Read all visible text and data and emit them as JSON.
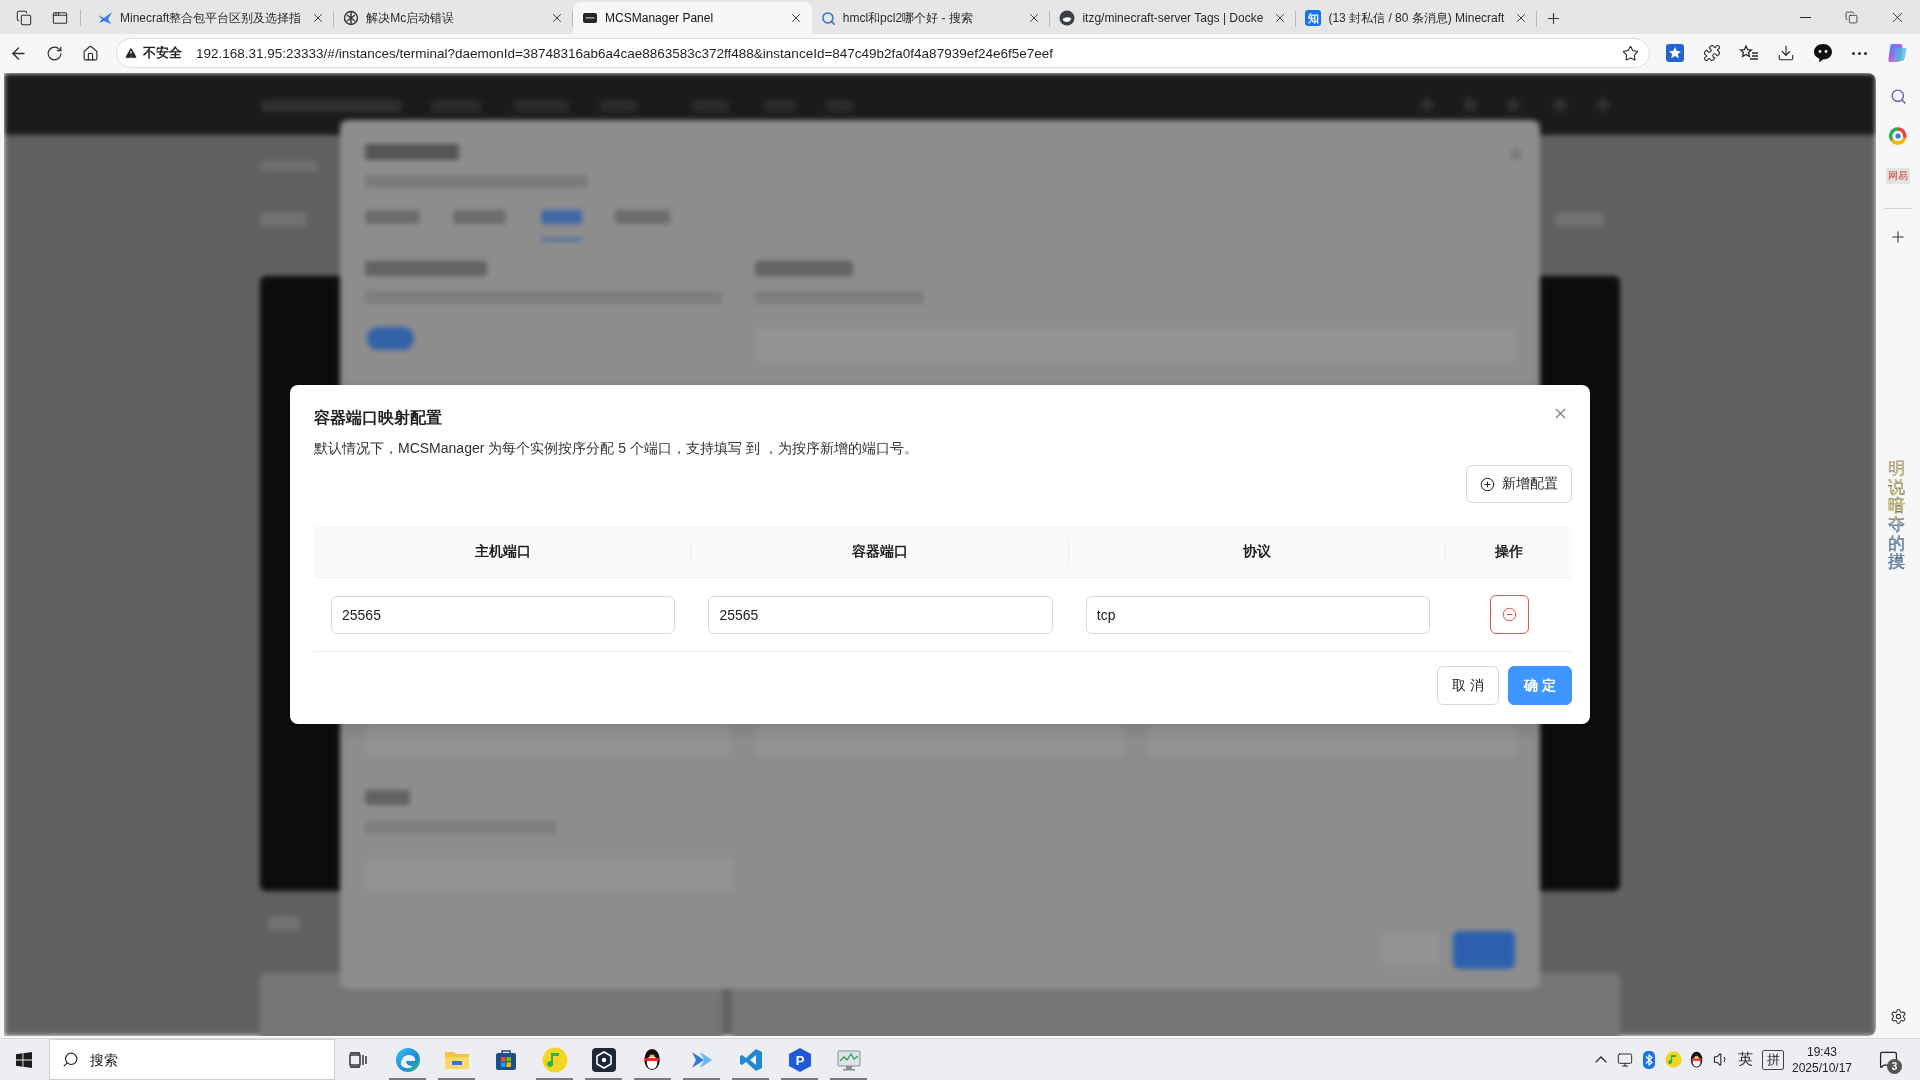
{
  "browser": {
    "tabs": [
      {
        "title": "Minecraft整合包平台区别及选择指",
        "selected": false
      },
      {
        "title": "解决Mc启动错误",
        "selected": false
      },
      {
        "title": "MCSManager Panel",
        "selected": true
      },
      {
        "title": "hmcl和pcl2哪个好 - 搜索",
        "selected": false
      },
      {
        "title": "itzg/minecraft-server Tags | Docke",
        "selected": false
      },
      {
        "title": "(13 封私信 / 80 条消息) Minecraft",
        "selected": false,
        "favicon_text": "知"
      }
    ],
    "address_bar": {
      "security_label": "不安全",
      "url": "192.168.31.95:23333/#/instances/terminal?daemonId=38748316ab6a4cae8863583c372ff488&instanceId=847c49b2fa0f4a87939ef24e6f5e7eef"
    },
    "sidebar": {
      "app_label": "网易"
    }
  },
  "dialog": {
    "title": "容器端口映射配置",
    "description": "默认情况下，MCSManager 为每个实例按序分配 5 个端口，支持填写 到 ，为按序新增的端口号。",
    "add_button": "新增配置",
    "table": {
      "columns": [
        "主机端口",
        "容器端口",
        "协议",
        "操作"
      ],
      "rows": [
        {
          "host_port": "25565",
          "container_port": "25565",
          "protocol": "tcp"
        }
      ]
    },
    "buttons": [
      {
        "label": "取 消",
        "kind": "default"
      },
      {
        "label": "确 定",
        "kind": "primary"
      }
    ]
  },
  "desktop_lyrics": "明说暗夺的摸",
  "taskbar": {
    "search": {
      "placeholder": "搜索"
    },
    "apps": [
      {
        "running": true
      },
      {
        "running": true
      },
      {
        "running": false
      },
      {
        "running": true
      },
      {
        "running": true
      },
      {
        "running": true
      },
      {
        "running": true
      },
      {
        "running": true
      },
      {
        "running": true,
        "glyph": "P"
      },
      {
        "running": true
      }
    ],
    "tray": {
      "input_language": "英",
      "input_mode": "拼",
      "time": "19:43",
      "date": "2025/10/17",
      "notification_count": "3"
    }
  }
}
